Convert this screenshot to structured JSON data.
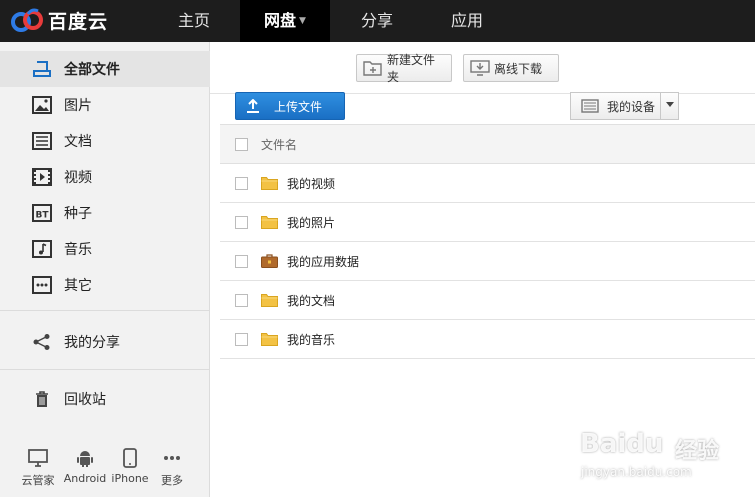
{
  "header": {
    "logo_text": "百度云",
    "nav": [
      {
        "label": "主页"
      },
      {
        "label": "网盘",
        "active": true
      },
      {
        "label": "分享"
      },
      {
        "label": "应用"
      }
    ]
  },
  "sidebar": {
    "items": [
      {
        "label": "全部文件",
        "icon": "all-files-icon",
        "active": true
      },
      {
        "label": "图片",
        "icon": "image-icon"
      },
      {
        "label": "文档",
        "icon": "document-icon"
      },
      {
        "label": "视频",
        "icon": "video-icon"
      },
      {
        "label": "种子",
        "icon": "bt-torrent-icon",
        "badge": "BT"
      },
      {
        "label": "音乐",
        "icon": "music-icon"
      },
      {
        "label": "其它",
        "icon": "more-dots-icon"
      }
    ],
    "share_label": "我的分享",
    "recycle_label": "回收站",
    "devices": [
      {
        "label": "云管家",
        "icon": "monitor-icon"
      },
      {
        "label": "Android",
        "icon": "android-icon"
      },
      {
        "label": "iPhone",
        "icon": "phone-icon"
      },
      {
        "label": "更多",
        "icon": "more-icon"
      }
    ]
  },
  "toolbar": {
    "new_folder_label": "新建文件夹",
    "offline_download_label": "离线下载",
    "upload_label": "上传文件",
    "device_select_label": "我的设备"
  },
  "file_list": {
    "header_label": "文件名",
    "rows": [
      {
        "name": "我的视频",
        "icon": "folder-icon"
      },
      {
        "name": "我的照片",
        "icon": "folder-icon"
      },
      {
        "name": "我的应用数据",
        "icon": "briefcase-folder-icon"
      },
      {
        "name": "我的文档",
        "icon": "folder-icon"
      },
      {
        "name": "我的音乐",
        "icon": "folder-icon"
      }
    ]
  },
  "watermark": {
    "brand": "Baidu",
    "brand_suffix": "经验",
    "url": "jingyan.baidu.com"
  },
  "colors": {
    "topbar": "#1d1d1d",
    "upload_button": "#1a6fc4",
    "folder": "#f3c244"
  }
}
